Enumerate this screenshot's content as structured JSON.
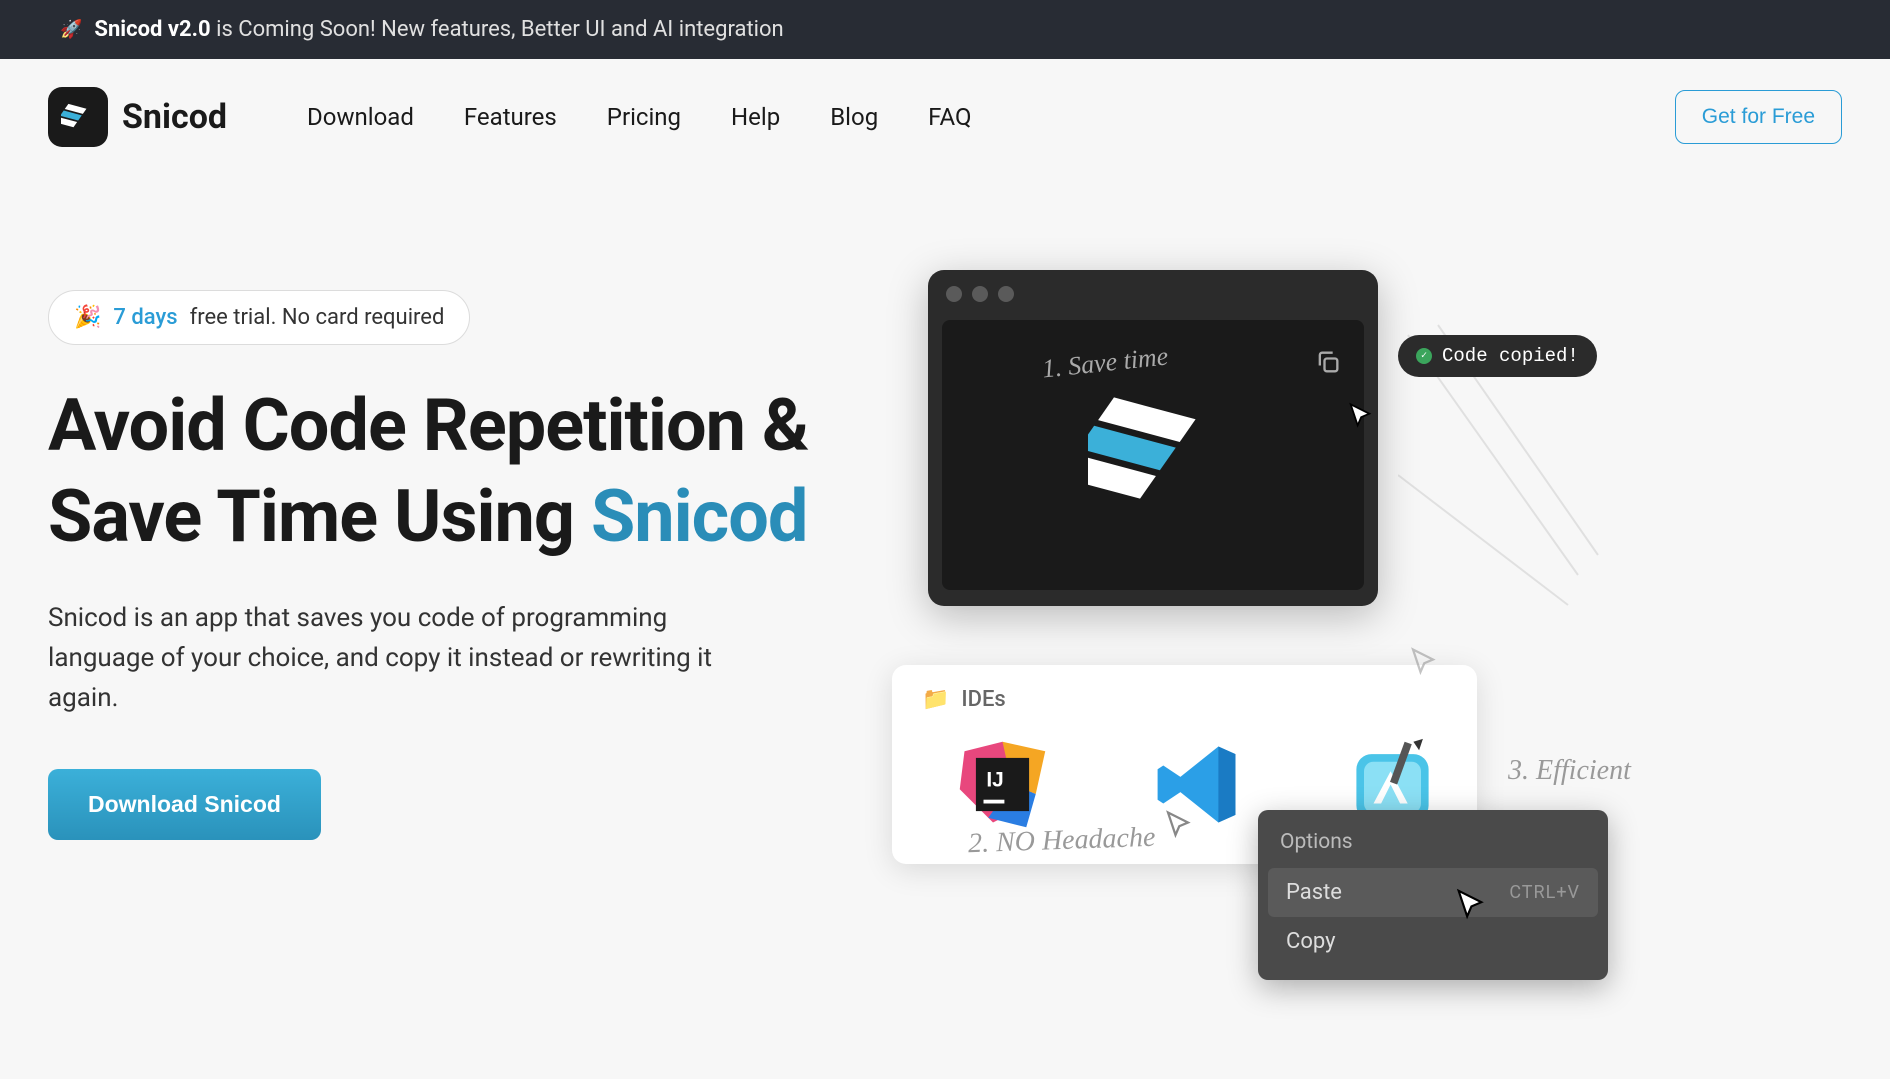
{
  "announcement": {
    "bold": "Snicod v2.0",
    "rest": "is Coming Soon! New features, Better UI and AI integration"
  },
  "nav": {
    "brand": "Snicod",
    "links": [
      "Download",
      "Features",
      "Pricing",
      "Help",
      "Blog",
      "FAQ"
    ],
    "cta": "Get for Free"
  },
  "trial": {
    "emoji": "🎉",
    "days": "7 days",
    "rest": "free trial. No card required"
  },
  "hero": {
    "title_main": "Avoid Code Repetition & Save Time Using ",
    "title_accent": "Snicod",
    "description": "Snicod is an app that saves you code of programming language of your choice, and copy it instead or rewriting it again.",
    "download": "Download Snicod"
  },
  "illustration": {
    "save_time": "1. Save time",
    "no_headache": "2. NO Headache",
    "efficient": "3. Efficient",
    "copied_toast": "Code copied!",
    "ides_label": "IDEs"
  },
  "context_menu": {
    "title": "Options",
    "paste": "Paste",
    "paste_shortcut": "CTRL+V",
    "copy": "Copy"
  },
  "colors": {
    "accent": "#2a9cd6",
    "dark": "#1a1a1a"
  }
}
